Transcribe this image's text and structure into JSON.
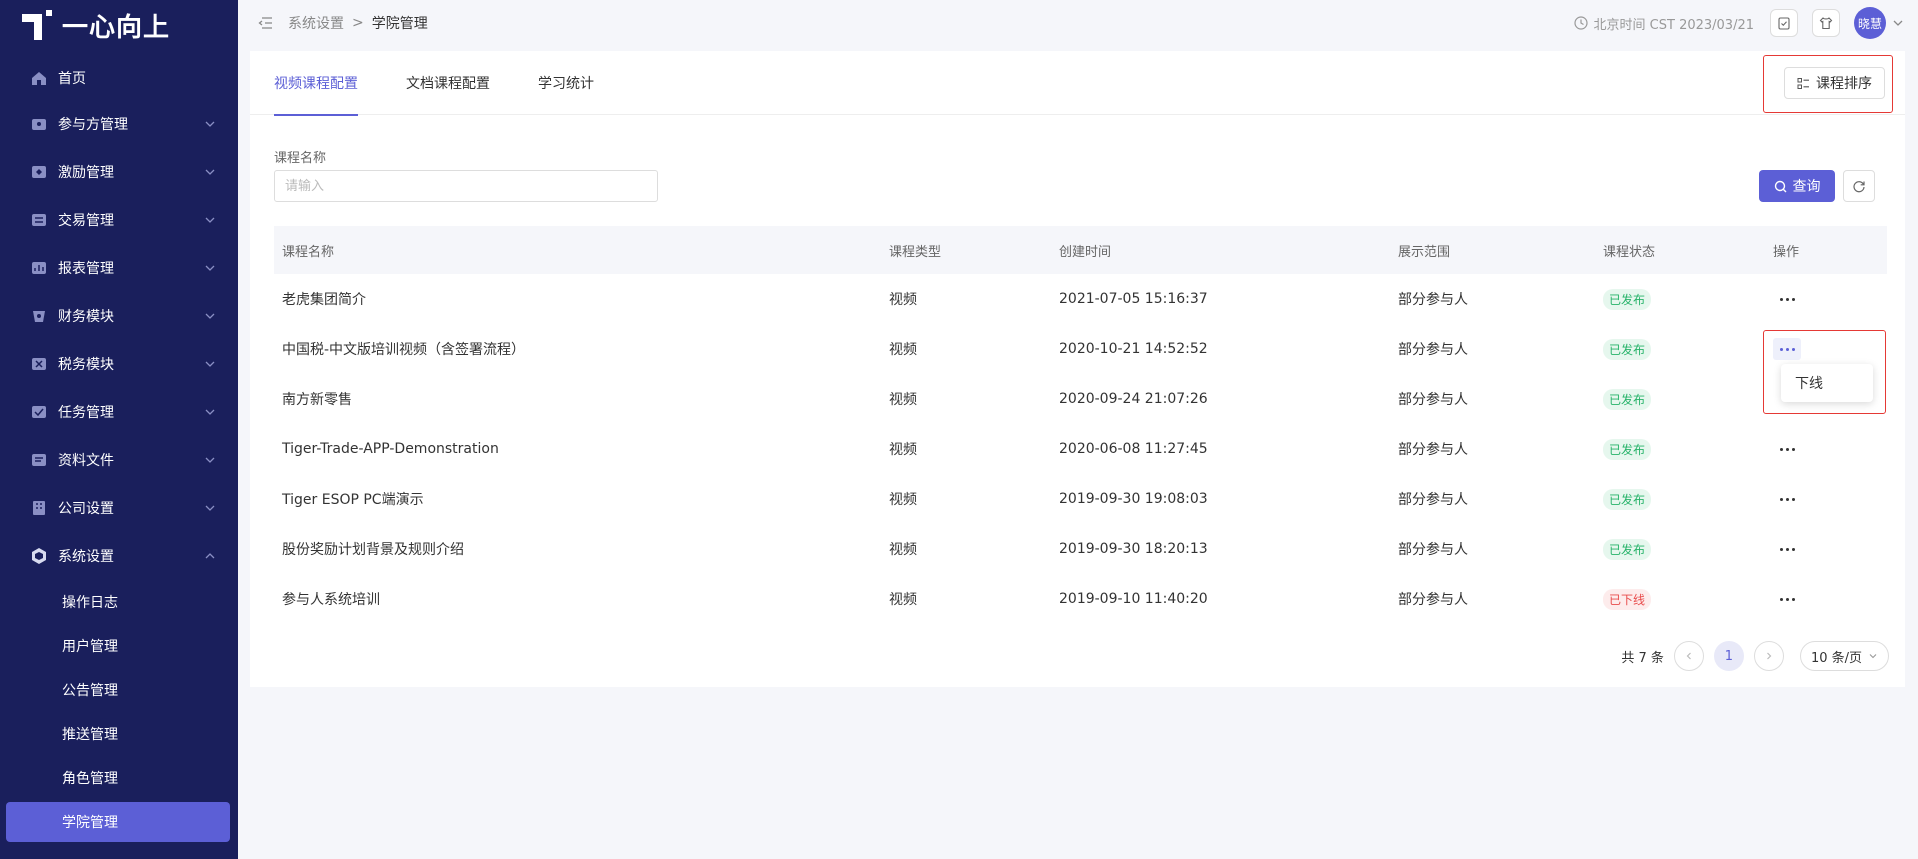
{
  "app": {
    "logo_text": "一心向上"
  },
  "sidebar": {
    "items": [
      {
        "label": "首页",
        "icon": "home-icon",
        "expandable": false
      },
      {
        "label": "参与方管理",
        "icon": "participants-icon",
        "expandable": true
      },
      {
        "label": "激励管理",
        "icon": "incentive-icon",
        "expandable": true
      },
      {
        "label": "交易管理",
        "icon": "trade-icon",
        "expandable": true
      },
      {
        "label": "报表管理",
        "icon": "report-icon",
        "expandable": true
      },
      {
        "label": "财务模块",
        "icon": "finance-icon",
        "expandable": true
      },
      {
        "label": "税务模块",
        "icon": "tax-icon",
        "expandable": true
      },
      {
        "label": "任务管理",
        "icon": "task-icon",
        "expandable": true
      },
      {
        "label": "资料文件",
        "icon": "files-icon",
        "expandable": true
      },
      {
        "label": "公司设置",
        "icon": "company-icon",
        "expandable": true
      },
      {
        "label": "系统设置",
        "icon": "system-icon",
        "expandable": true,
        "expanded": true
      }
    ],
    "sub_items": [
      {
        "label": "操作日志"
      },
      {
        "label": "用户管理"
      },
      {
        "label": "公告管理"
      },
      {
        "label": "推送管理"
      },
      {
        "label": "角色管理"
      },
      {
        "label": "学院管理",
        "active": true
      }
    ]
  },
  "header": {
    "breadcrumb": {
      "parent": "系统设置",
      "separator": ">",
      "current": "学院管理"
    },
    "time_text": "北京时间 CST 2023/03/21",
    "avatar_text": "晓慧"
  },
  "tabs": [
    {
      "label": "视频课程配置",
      "active": true
    },
    {
      "label": "文档课程配置"
    },
    {
      "label": "学习统计"
    }
  ],
  "sort_button": "课程排序",
  "filter": {
    "label": "课程名称",
    "placeholder": "请输入"
  },
  "query_button": "查询",
  "table": {
    "headers": [
      "课程名称",
      "课程类型",
      "创建时间",
      "展示范围",
      "课程状态",
      "操作"
    ],
    "rows": [
      {
        "name": "老虎集团简介",
        "type": "视频",
        "created": "2021-07-05 15:16:37",
        "scope": "部分参与人",
        "status": "已发布",
        "status_kind": "published"
      },
      {
        "name": "中国税-中文版培训视频（含签署流程）",
        "type": "视频",
        "created": "2020-10-21 14:52:52",
        "scope": "部分参与人",
        "status": "已发布",
        "status_kind": "published"
      },
      {
        "name": "南方新零售",
        "type": "视频",
        "created": "2020-09-24 21:07:26",
        "scope": "部分参与人",
        "status": "已发布",
        "status_kind": "published"
      },
      {
        "name": "Tiger-Trade-APP-Demonstration",
        "type": "视频",
        "created": "2020-06-08 11:27:45",
        "scope": "部分参与人",
        "status": "已发布",
        "status_kind": "published"
      },
      {
        "name": "Tiger ESOP PC端演示",
        "type": "视频",
        "created": "2019-09-30 19:08:03",
        "scope": "部分参与人",
        "status": "已发布",
        "status_kind": "published"
      },
      {
        "name": "股份奖励计划背景及规则介绍",
        "type": "视频",
        "created": "2019-09-30 18:20:13",
        "scope": "部分参与人",
        "status": "已发布",
        "status_kind": "published"
      },
      {
        "name": "参与人系统培训",
        "type": "视频",
        "created": "2019-09-10 11:40:20",
        "scope": "部分参与人",
        "status": "已下线",
        "status_kind": "offline"
      }
    ]
  },
  "row_menu": {
    "item": "下线"
  },
  "pagination": {
    "total_text": "共 7 条",
    "current_page": "1",
    "page_size": "10 条/页"
  },
  "colors": {
    "sidebar_bg": "#1a1f5c",
    "accent": "#5c5fd6",
    "published": "#27b36a",
    "offline": "#e84c4c",
    "highlight": "#e53935"
  }
}
